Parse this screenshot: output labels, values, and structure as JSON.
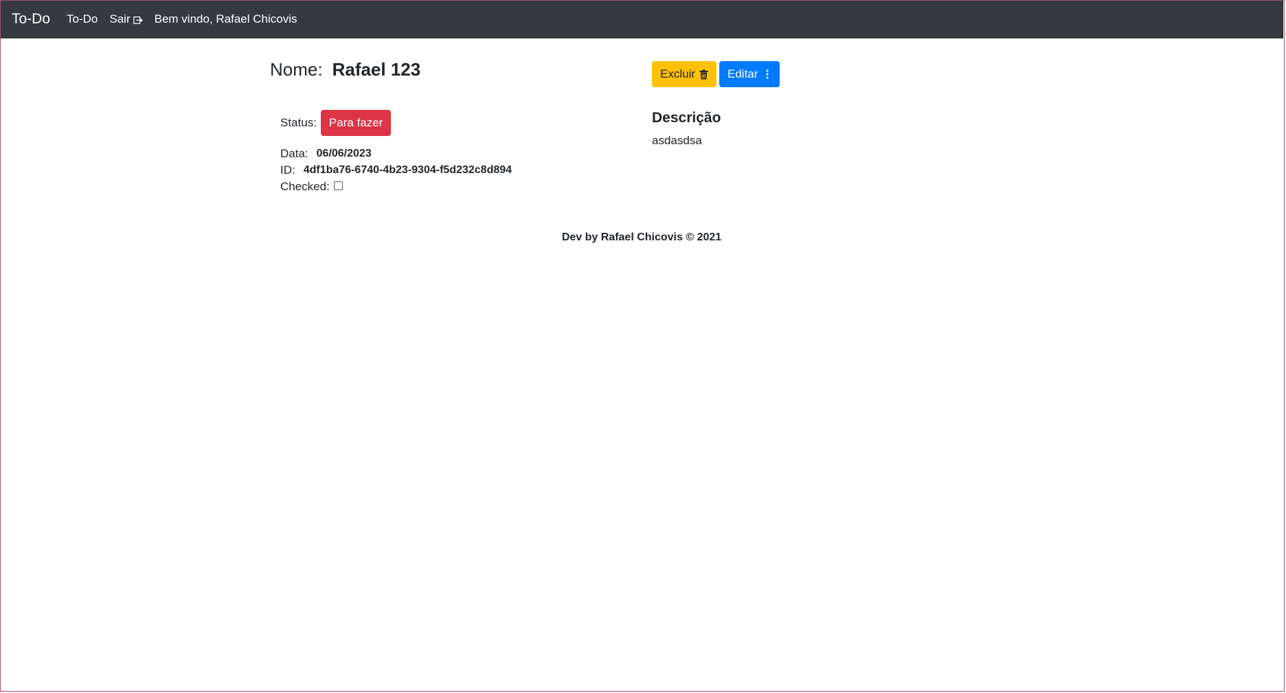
{
  "navbar": {
    "brand": "To-Do",
    "todo_link": "To-Do",
    "logout_label": "Sair",
    "welcome": "Bem vindo, Rafael Chicovis"
  },
  "task": {
    "name_label": "Nome:",
    "name_value": "Rafael 123",
    "status_label": "Status:",
    "status_value": "Para fazer",
    "date_label": "Data:",
    "date_value": "06/06/2023",
    "id_label": "ID:",
    "id_value": "4df1ba76-6740-4b23-9304-f5d232c8d894",
    "checked_label": "Checked:",
    "checked": false
  },
  "actions": {
    "delete_label": "Excluir",
    "edit_label": "Editar"
  },
  "description": {
    "title": "Descrição",
    "text": "asdasdsa"
  },
  "footer": {
    "text": "Dev by Rafael Chicovis © 2021"
  },
  "colors": {
    "navbar_bg": "#343a40",
    "warning": "#ffc107",
    "primary": "#007bff",
    "danger": "#dc3545"
  }
}
